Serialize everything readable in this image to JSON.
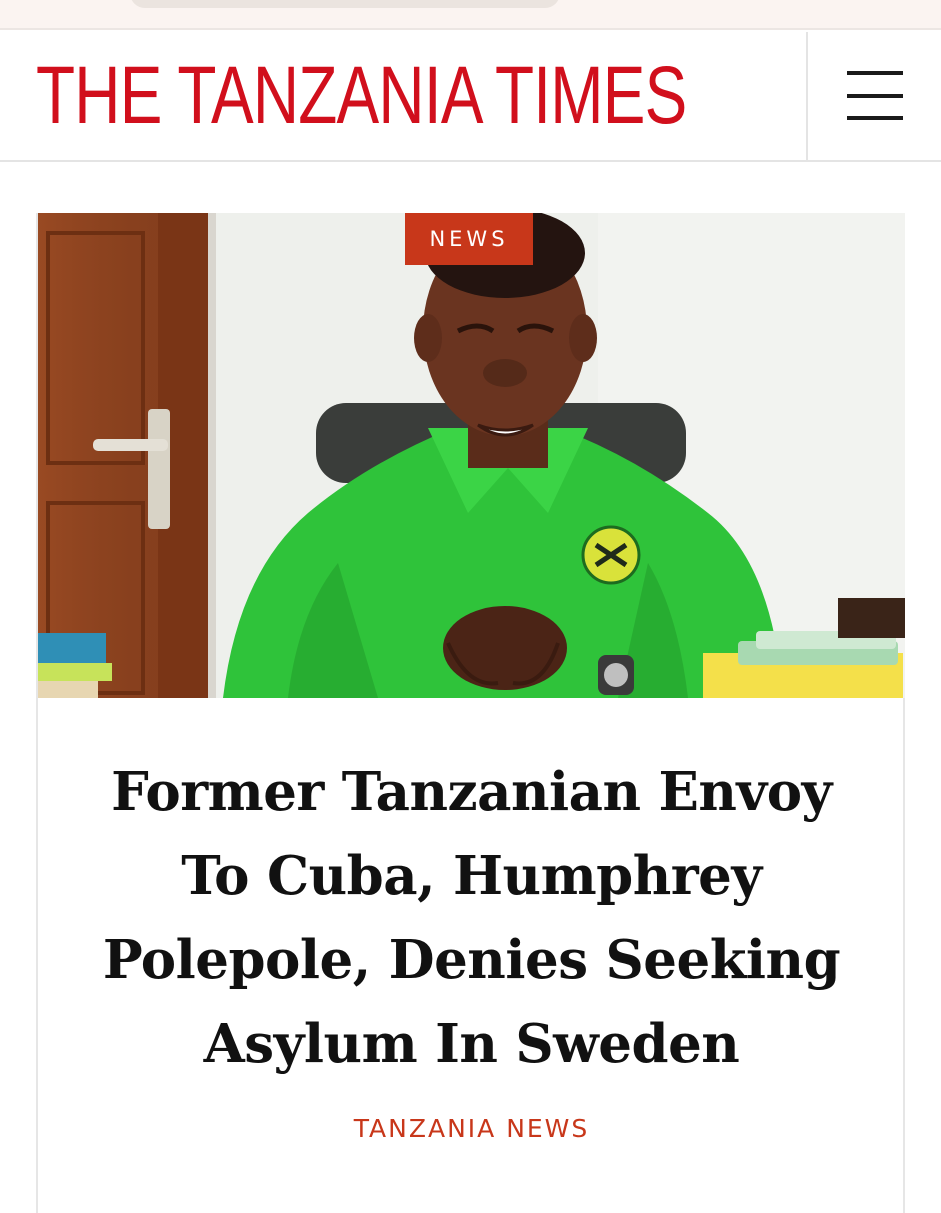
{
  "browser": {},
  "site": {
    "logo_text": "THE TANZANIA TIMES",
    "brand_color": "#d10f1c",
    "accent_color": "#c8371a",
    "menu_icon": "hamburger-menu-icon"
  },
  "article": {
    "category": "NEWS",
    "headline": "Former Tanzanian Envoy To Cuba, Humphrey Polepole, Denies Seeking Asylum In Sweden",
    "section": "TANZANIA NEWS",
    "image_description": ""
  }
}
